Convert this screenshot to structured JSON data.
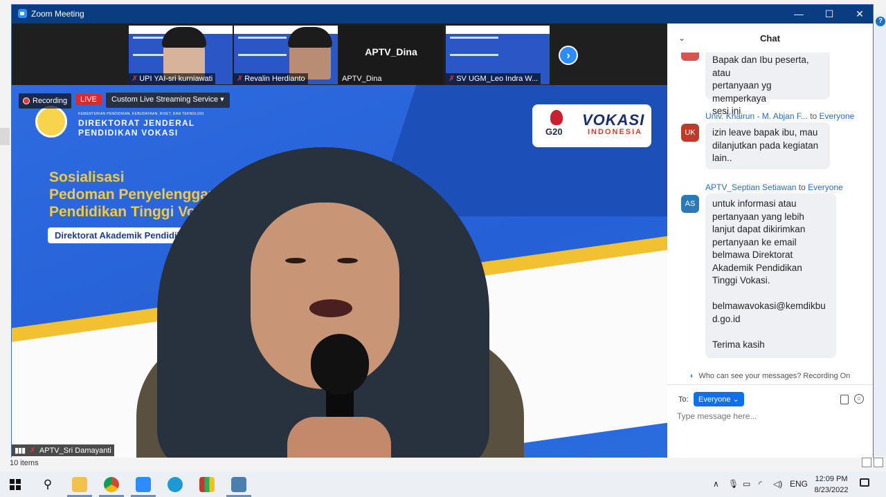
{
  "window": {
    "title": "Zoom Meeting",
    "minimize": "—",
    "maximize": "☐",
    "close": "✕"
  },
  "thumbnails": [
    {
      "name": "UPI YAI-sri kurniawati",
      "type": "video"
    },
    {
      "name": "Revalin Herdianto",
      "type": "video"
    },
    {
      "name": "APTV_Dina",
      "type": "name-only",
      "display": "APTV_Dina"
    },
    {
      "name": "SV UGM_Leo Indra W...",
      "type": "slide"
    }
  ],
  "main_video": {
    "recording_label": "Recording",
    "live_label": "LIVE",
    "stream_service": "Custom Live Streaming Service",
    "stream_caret": "▾",
    "speaker_name": "APTV_Sri Damayanti",
    "slide": {
      "ministry_small": "KEMENTERIAN PENDIDIKAN, KEBUDAYAAN, RISET, DAN TEKNOLOGI",
      "ministry_line1": "DIREKTORAT JENDERAL",
      "ministry_line2": "PENDIDIKAN VOKASI",
      "title_line1": "Sosialisasi",
      "title_line2": "Pedoman Penyelenggaraan P",
      "title_line3": "Pendidikan Tinggi Vokasi",
      "pill": "Direktorat Akademik Pendidikan Tinggi",
      "g20": "G20",
      "vokasi": "VOKASI",
      "vokasi_sub": "INDONESIA"
    }
  },
  "chat": {
    "title": "Chat",
    "collapse_icon": "⌄",
    "messages": [
      {
        "sender": "",
        "to": "",
        "avatar": "",
        "avatar_color": "#d9534f",
        "text": "Bapak dan Ibu peserta, atau\npertanyaan yg memperkaya\nsesi ini"
      },
      {
        "sender": "Univ. Khairun - M. Abjan F...",
        "to_word": "to",
        "to": "Everyone",
        "avatar": "UK",
        "avatar_color": "#c0392b",
        "text": "izin leave bapak ibu, mau\ndilanjutkan pada kegiatan\nlain.."
      },
      {
        "sender": "APTV_Septian Setiawan",
        "to_word": "to",
        "to": "Everyone",
        "avatar": "AS",
        "avatar_color": "#2a7ab8",
        "text": "untuk informasi atau\npertanyaan yang lebih\nlanjut dapat dikirimkan\npertanyaan ke email\nbelmawa Direktorat\nAkademik Pendidikan\nTinggi Vokasi.\n\nbelmawavokasi@kemdikbu\nd.go.id\n\nTerima kasih"
      }
    ],
    "who_can_see": "Who can see your messages? Recording On",
    "to_label": "To:",
    "recipient": "Everyone ⌄",
    "input_placeholder": "Type message here..."
  },
  "explorer": {
    "status_items": "10 items"
  },
  "taskbar": {
    "tray_up": "∧",
    "tray_lang": "ENG",
    "time": "12:09 PM",
    "date": "8/23/2022"
  }
}
